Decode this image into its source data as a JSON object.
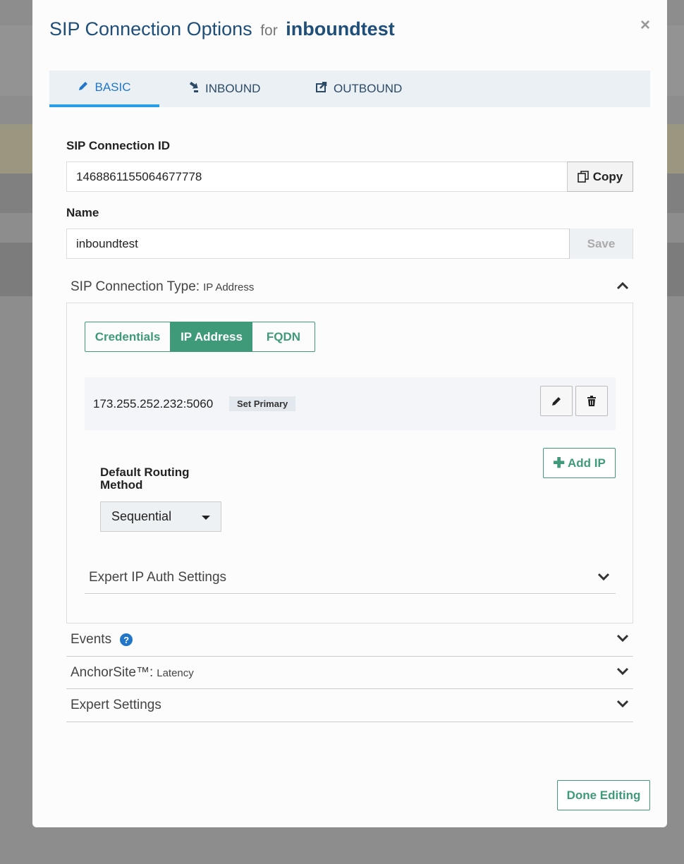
{
  "modal": {
    "title": "SIP Connection Options",
    "for_text": "for",
    "connection_name": "inboundtest",
    "close_glyph": "×"
  },
  "tabs": [
    {
      "label": "BASIC",
      "icon": "pencil-icon"
    },
    {
      "label": "INBOUND",
      "icon": "inbound-icon"
    },
    {
      "label": "OUTBOUND",
      "icon": "outbound-icon"
    }
  ],
  "connection_id": {
    "label": "SIP Connection ID",
    "value": "1468861155064677778",
    "copy_label": "Copy"
  },
  "name": {
    "label": "Name",
    "value": "inboundtest",
    "save_label": "Save"
  },
  "connection_type": {
    "label": "SIP Connection Type:",
    "value": "IP Address",
    "options": [
      "Credentials",
      "IP Address",
      "FQDN"
    ],
    "selected": "IP Address"
  },
  "ip_entry": {
    "address": "173.255.252.232:5060",
    "set_primary_label": "Set Primary"
  },
  "add_ip_label": "Add IP",
  "routing": {
    "label": "Default Routing Method",
    "value": "Sequential"
  },
  "expert_ip_auth_label": "Expert IP Auth Settings",
  "events_label": "Events",
  "anchorsite": {
    "label": "AnchorSite™:",
    "value": "Latency"
  },
  "expert_settings_label": "Expert Settings",
  "done_label": "Done Editing",
  "colors": {
    "accent_green": "#3f9a79",
    "tab_active_blue": "#2b9ee8",
    "title_blue": "#1f4e79"
  }
}
